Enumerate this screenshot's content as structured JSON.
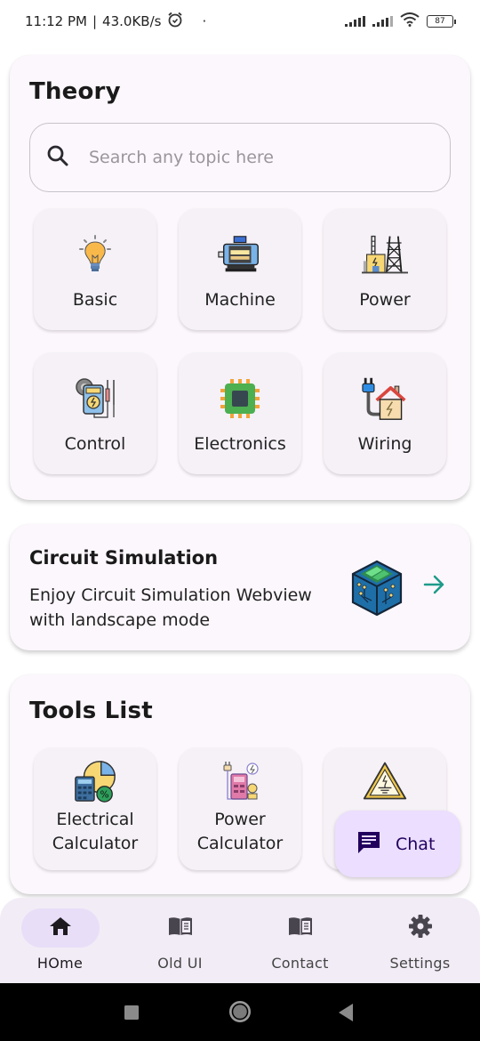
{
  "status_bar": {
    "time": "11:12 PM",
    "network_speed": "43.0KB/s",
    "separator": "|",
    "dot": "·",
    "battery": "87",
    "icons": [
      "alarm-icon",
      "signal-icon",
      "signal-icon",
      "wifi-icon",
      "battery-icon"
    ]
  },
  "theory": {
    "title": "Theory",
    "search": {
      "placeholder": "Search any topic here",
      "value": "",
      "icon": "search-icon"
    },
    "items": [
      {
        "label": "Basic",
        "icon": "lightbulb-icon"
      },
      {
        "label": "Machine",
        "icon": "motor-icon"
      },
      {
        "label": "Power",
        "icon": "power-plant-icon"
      },
      {
        "label": "Control",
        "icon": "multimeter-icon"
      },
      {
        "label": "Electronics",
        "icon": "chip-icon"
      },
      {
        "label": "Wiring",
        "icon": "house-plug-icon"
      }
    ]
  },
  "simulation": {
    "title": "Circuit Simulation",
    "description": "Enjoy Circuit Simulation Webview with landscape mode",
    "icon": "circuit-cube-icon",
    "action_icon": "arrow-right-icon",
    "accent": "#1e9b8a"
  },
  "tools": {
    "title": "Tools List",
    "items": [
      {
        "label": "Electrical Calculator",
        "icon": "calculator-chart-icon"
      },
      {
        "label": "Power Calculator",
        "icon": "power-calculator-icon"
      },
      {
        "label": "",
        "icon": "electrical-warning-icon"
      }
    ]
  },
  "chat_fab": {
    "label": "Chat",
    "icon": "chat-icon",
    "bg": "#ebdeff",
    "fg": "#21005d"
  },
  "bottom_nav": {
    "active_index": 0,
    "items": [
      {
        "label": "HOme",
        "icon": "home-icon"
      },
      {
        "label": "Old UI",
        "icon": "book-icon"
      },
      {
        "label": "Contact",
        "icon": "book-icon"
      },
      {
        "label": "Settings",
        "icon": "gear-icon"
      }
    ]
  },
  "system_nav": {
    "buttons": [
      "recents-button",
      "home-button",
      "back-button"
    ]
  }
}
